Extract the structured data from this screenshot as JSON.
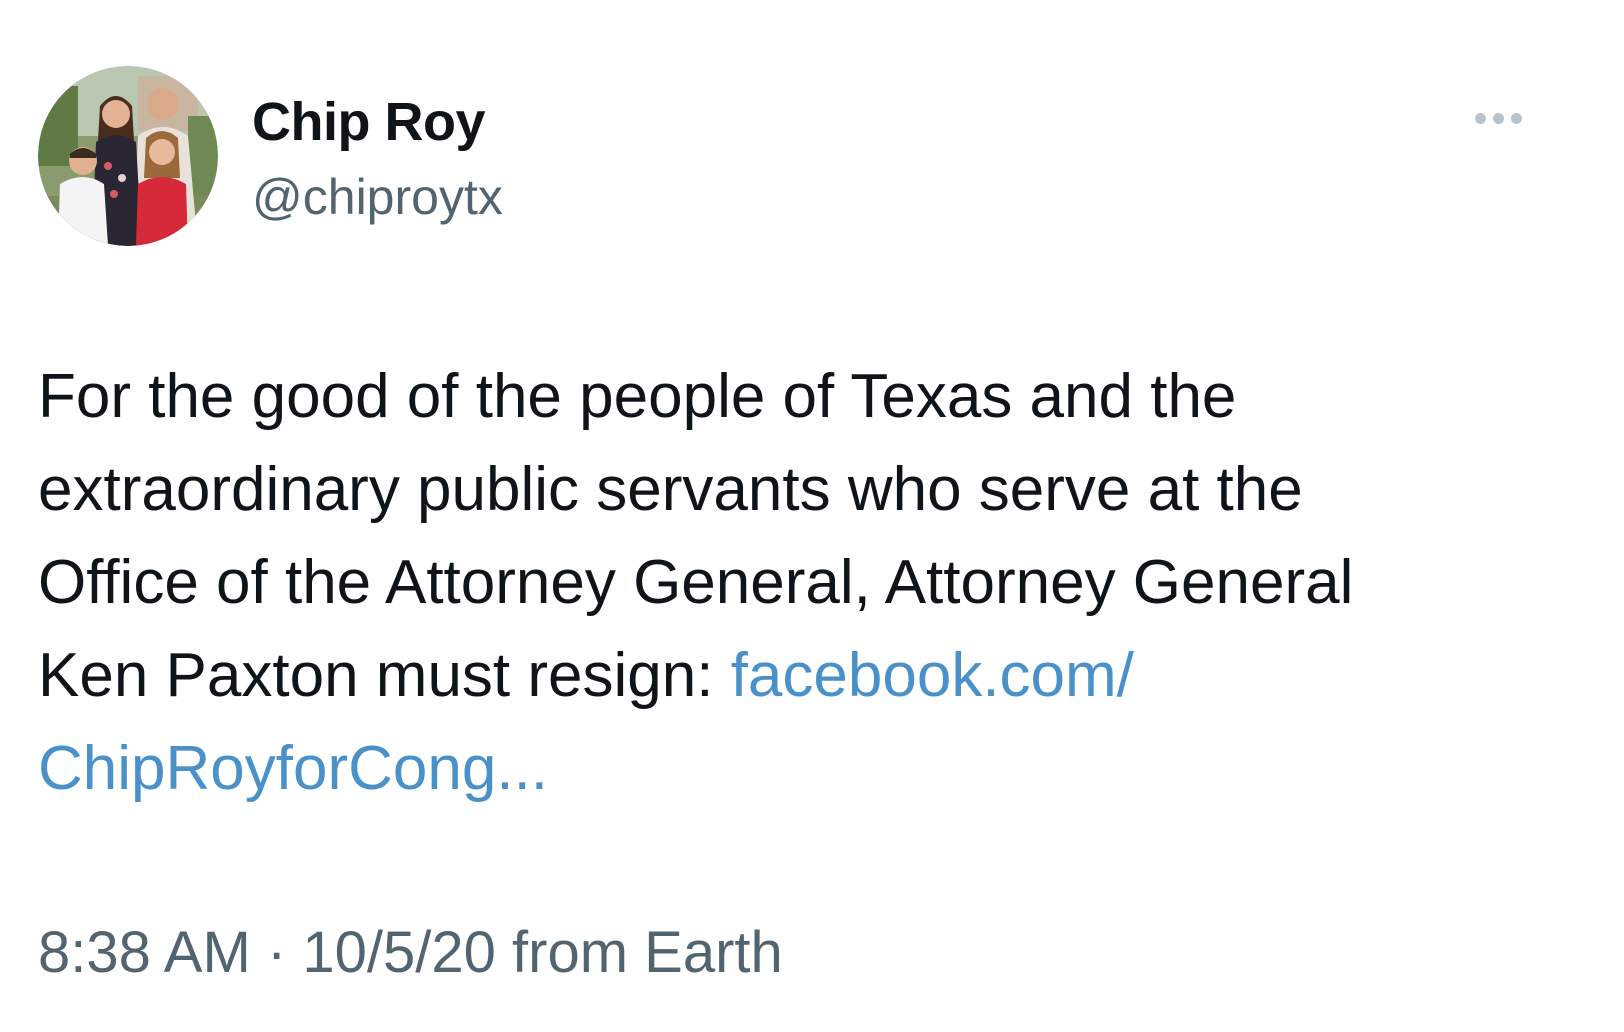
{
  "author": {
    "display_name": "Chip Roy",
    "handle": "@chiproytx",
    "avatar": "family-photo-avatar"
  },
  "menu": {
    "icon": "more-options-icon"
  },
  "tweet": {
    "lines": [
      "For the good of the people of Texas and the",
      "extraordinary public servants who serve at the",
      "Office of the Attorney General, Attorney General",
      "Ken Paxton must resign: "
    ],
    "link_part1": "facebook.com/",
    "link_part2": "ChipRoyforCong..."
  },
  "meta": {
    "time": "8:38 AM",
    "separator": "·",
    "date": "10/5/20",
    "source": "from Earth"
  },
  "colors": {
    "link": "#4a90c9",
    "secondary_text": "#536471",
    "primary_text": "#0f1419"
  }
}
